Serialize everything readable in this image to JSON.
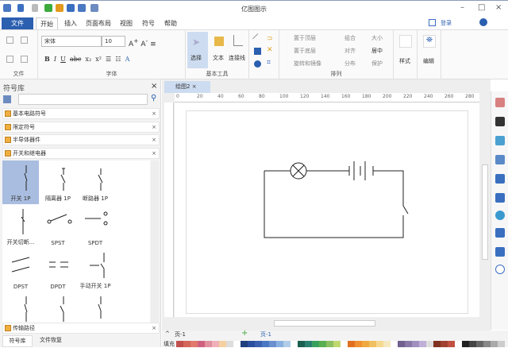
{
  "app": {
    "title": "亿图图示"
  },
  "menu": {
    "file": "文件",
    "tabs": [
      "开始",
      "插入",
      "页面布局",
      "视图",
      "符号",
      "帮助"
    ],
    "login": "登录"
  },
  "ribbon": {
    "font_name": "宋体",
    "font_size": "10",
    "groups": {
      "file": "文件",
      "font": "字体",
      "basic_tools": "基本工具",
      "arrange": "排列"
    },
    "tools": {
      "select": "选择",
      "text": "文本",
      "connector": "连接线"
    },
    "arrange": [
      "置于顶层",
      "置于底层",
      "旋转和镜像",
      "组合",
      "对齐",
      "分布",
      "大小",
      "居中",
      "保护"
    ],
    "style": "样式",
    "edit": "编辑"
  },
  "panel": {
    "title": "符号库",
    "categories": [
      "基本电路符号",
      "限定符号",
      "半导体器件",
      "开关和继电器"
    ],
    "symbols": [
      "开关 1P",
      "隔离器 1P",
      "断路器 1P",
      "开关切断...",
      "SPST",
      "SPDT",
      "DPST",
      "DPDT",
      "手动开关 1P"
    ],
    "bottom_category": "传输路径",
    "bottom_tabs": [
      "符号库",
      "文件恢复"
    ]
  },
  "document": {
    "tab": "绘图2",
    "ruler": [
      "0",
      "20",
      "40",
      "60",
      "80",
      "100",
      "120",
      "140",
      "160",
      "180",
      "200",
      "220",
      "240",
      "260",
      "280"
    ]
  },
  "status": {
    "page_select": "页-1",
    "page_tab": "页-1",
    "fill_label": "填充"
  },
  "colors": {
    "file_tab": "#2b5fb0",
    "selected_symbol": "#a9bde0"
  }
}
